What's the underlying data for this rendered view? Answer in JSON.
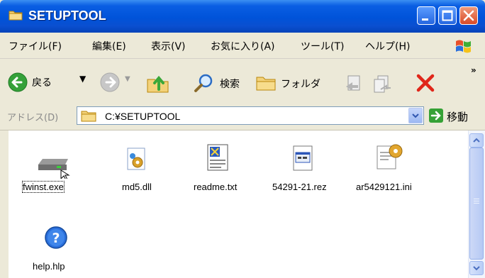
{
  "window": {
    "title": "SETUPTOOL"
  },
  "menu": [
    "ファイル(F)",
    "編集(E)",
    "表示(V)",
    "お気に入り(A)",
    "ツール(T)",
    "ヘルプ(H)"
  ],
  "toolbar": {
    "back_label": "戻る",
    "search_label": "検索",
    "folders_label": "フォルダ",
    "overflow": "»"
  },
  "address": {
    "label": "アドレス(D)",
    "path": "C:¥SETUPTOOL",
    "go_label": "移動"
  },
  "files": [
    {
      "name": "fwinst.exe",
      "icon": "drive-exe-icon",
      "selected": true
    },
    {
      "name": "md5.dll",
      "icon": "dll-gear-icon"
    },
    {
      "name": "readme.txt",
      "icon": "text-document-icon"
    },
    {
      "name": "54291-21.rez",
      "icon": "rez-window-icon"
    },
    {
      "name": "ar5429121.ini",
      "icon": "ini-settings-icon"
    },
    {
      "name": "help.hlp",
      "icon": "help-icon"
    }
  ]
}
